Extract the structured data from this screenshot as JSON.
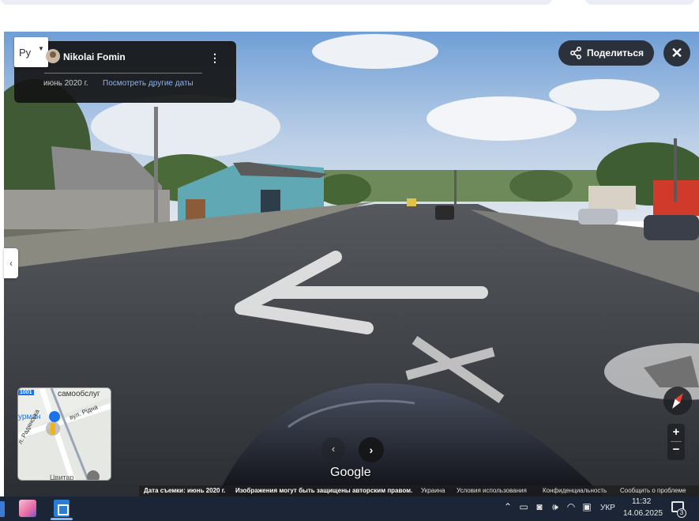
{
  "language_selector": {
    "label": "Ру"
  },
  "info_card": {
    "author": "Nikolai Fomin",
    "capture_date": "июнь 2020 г.",
    "other_dates_link": "Посмотреть другие даты"
  },
  "share_button": {
    "label": "Поделиться"
  },
  "minimap": {
    "labels": {
      "road_number": "1001",
      "business": "самообслуг",
      "place": "урман",
      "street_1": "вул. Рідна",
      "street_2": "л. Радянська",
      "bottom": "Цвитар"
    }
  },
  "branding": {
    "logo": "Google"
  },
  "attribution": {
    "capture_date": "Дата съемки: июнь 2020 г.",
    "copyright": "Изображения могут быть защищены авторским правом.",
    "country": "Украина",
    "terms": "Условия использования",
    "privacy": "Конфиденциальность",
    "report": "Сообщить о проблеме"
  },
  "taskbar": {
    "keyboard_language": "УКР",
    "time": "11:32",
    "date": "14.06.2025",
    "notification_count": "3"
  },
  "colors": {
    "panel_dark": "#202124",
    "link_blue": "#8ab4f8",
    "taskbar": "#1b2535"
  }
}
